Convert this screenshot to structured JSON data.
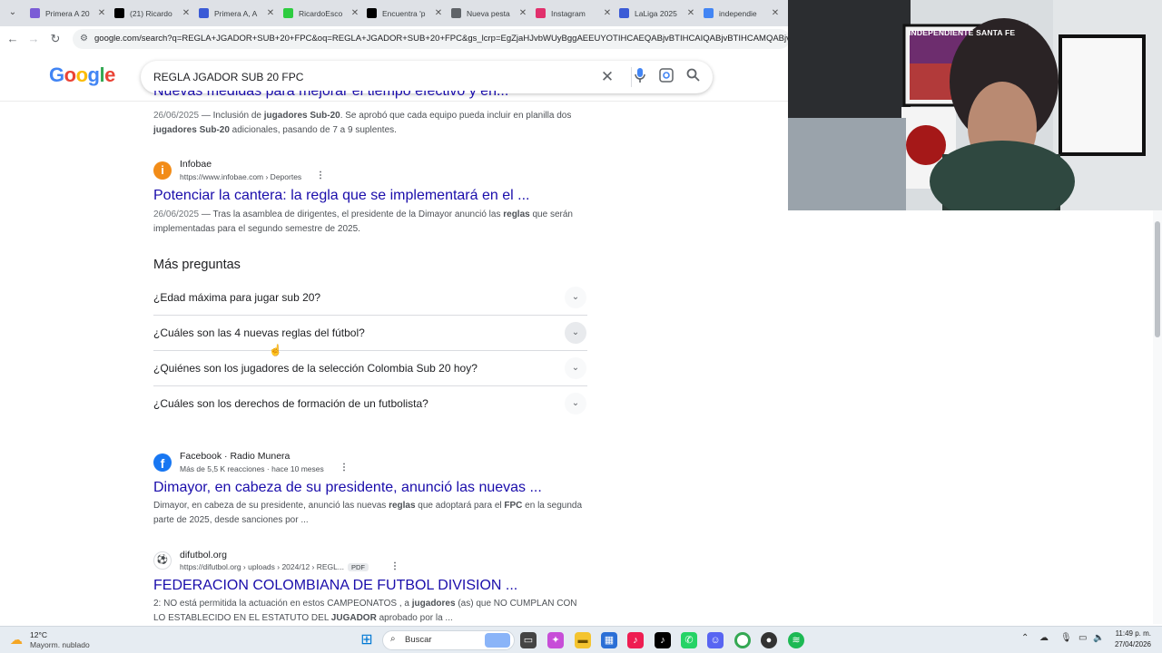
{
  "browser": {
    "tabs": [
      {
        "label": "Primera A 20",
        "color": "#7b5cd6"
      },
      {
        "label": "(21) Ricardo",
        "color": "#000000"
      },
      {
        "label": "Primera A, A",
        "color": "#3b5bd6"
      },
      {
        "label": "RicardoEsco",
        "color": "#2ecc40"
      },
      {
        "label": "Encuentra 'p",
        "color": "#000000"
      },
      {
        "label": "Nueva pesta",
        "color": "#5f6368"
      },
      {
        "label": "Instagram",
        "color": "#e1306c"
      },
      {
        "label": "LaLiga 2025",
        "color": "#3b5bd6"
      },
      {
        "label": "independie",
        "color": "#4285f4"
      }
    ],
    "url": "google.com/search?q=REGLA+JGADOR+SUB+20+FPC&oq=REGLA+JGADOR+SUB+20+FPC&gs_lcrp=EgZjaHJvbWUyBggAEEUYOTIHCAEQABjvBTIHCAIQABjvBTIHCAMQABjvBTIHCAQQA"
  },
  "google": {
    "logo": "Google",
    "query": "REGLA JGADOR SUB 20 FPC"
  },
  "results": {
    "top_title_partial": "Nuevas medidas para mejorar el tiempo efectivo y en...",
    "top_snippet": {
      "date": "26/06/2025",
      "parts": [
        " — Inclusión de ",
        "jugadores Sub-20",
        ". Se aprobó que cada equipo pueda incluir en planilla dos ",
        "jugadores Sub-20",
        " adicionales, pasando de 7 a 9 suplentes."
      ]
    },
    "infobae": {
      "site": "Infobae",
      "url": "https://www.infobae.com › Deportes",
      "title": "Potenciar la cantera: la regla que se implementará en el ...",
      "date": "26/06/2025",
      "parts": [
        " — Tras la asamblea de dirigentes, el presidente de la Dimayor anunció las ",
        "reglas",
        " que serán implementadas para el segundo semestre de 2025."
      ]
    },
    "paa": {
      "title": "Más preguntas",
      "questions": [
        "¿Edad máxima para jugar sub 20?",
        "¿Cuáles son las 4 nuevas reglas del fútbol?",
        "¿Quiénes son los jugadores de la selección Colombia Sub 20 hoy?",
        "¿Cuáles son los derechos de formación de un futbolista?"
      ]
    },
    "facebook": {
      "site": "Facebook · Radio Munera",
      "meta": "Más de 5,5 K reacciones · hace 10 meses",
      "title": "Dimayor, en cabeza de su presidente, anunció las nuevas ...",
      "parts": [
        "Dimayor, en cabeza de su presidente, anunció las nuevas ",
        "reglas",
        " que adoptará para el ",
        "FPC",
        " en la segunda parte de 2025, desde sanciones por ..."
      ]
    },
    "difutbol": {
      "site": "difutbol.org",
      "url": "https://difutbol.org › uploads › 2024/12 › REGL...",
      "badge": "PDF",
      "title": "FEDERACION COLOMBIANA DE FUTBOL DIVISION ...",
      "parts": [
        "2: NO está permitida la actuación en estos CAMPEONATOS , a ",
        "jugadores",
        " (as) que NO CUMPLAN CON LO ESTABLECIDO EN EL ESTATUTO DEL ",
        "JUGADOR",
        " aprobado por la ..."
      ]
    }
  },
  "webcam": {
    "banner": "INDEPENDIENTE SANTA FE"
  },
  "taskbar": {
    "weather_temp": "12°C",
    "weather_desc": "Mayorm. nublado",
    "search_label": "Buscar",
    "time": "11:49 p. m.",
    "date": "27/04/2026"
  }
}
